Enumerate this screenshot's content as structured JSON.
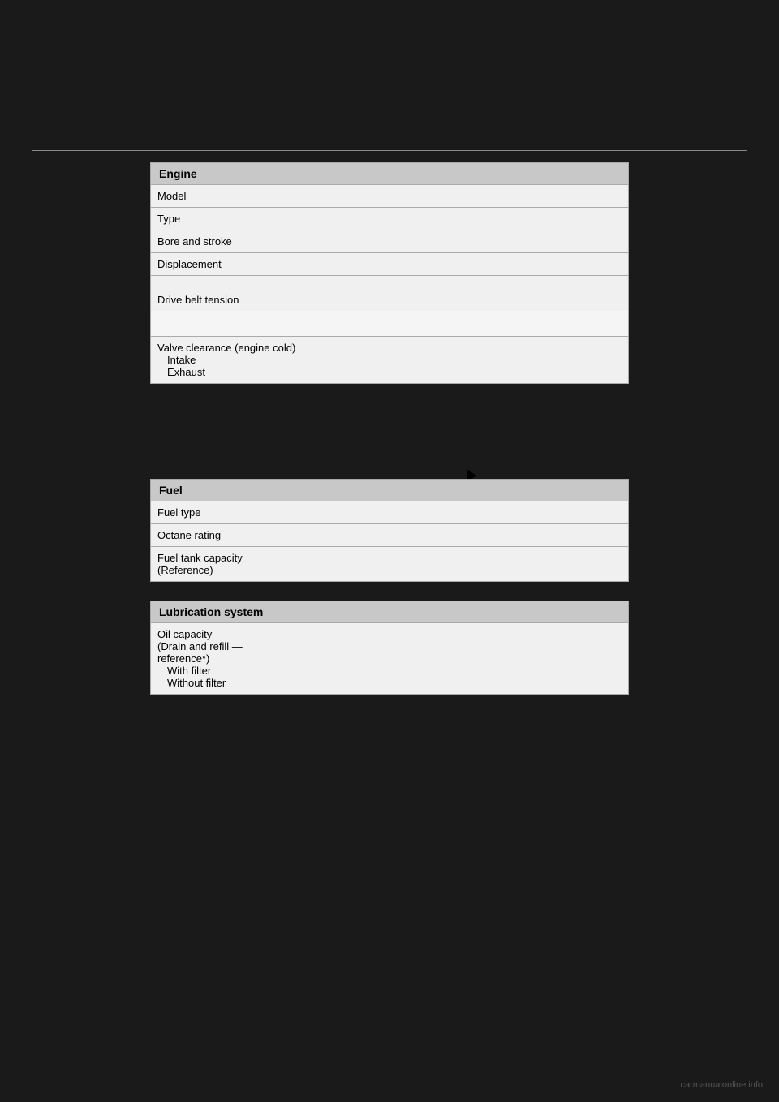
{
  "page": {
    "background_color": "#1a1a1a",
    "watermark": "carmanualonline.info"
  },
  "sections": {
    "engine": {
      "header": "Engine",
      "rows": [
        {
          "label": "Model"
        },
        {
          "label": "Type"
        },
        {
          "label": "Bore and stroke"
        },
        {
          "label": "Displacement"
        },
        {
          "label": "Drive belt tension",
          "multi_line": true
        },
        {
          "label": "Valve clearance (engine cold)\n    Intake\n    Exhaust",
          "multi_line": true
        }
      ]
    },
    "fuel": {
      "header": "Fuel",
      "rows": [
        {
          "label": "Fuel type"
        },
        {
          "label": "Octane rating"
        },
        {
          "label": "Fuel tank capacity\n(Reference)",
          "multi_line": true
        }
      ]
    },
    "lubrication": {
      "header": "Lubrication system",
      "rows": [
        {
          "label": "Oil capacity\n(Drain and refill —\nreference*)\n    With filter\n    Without filter",
          "multi_line": true
        }
      ]
    }
  }
}
